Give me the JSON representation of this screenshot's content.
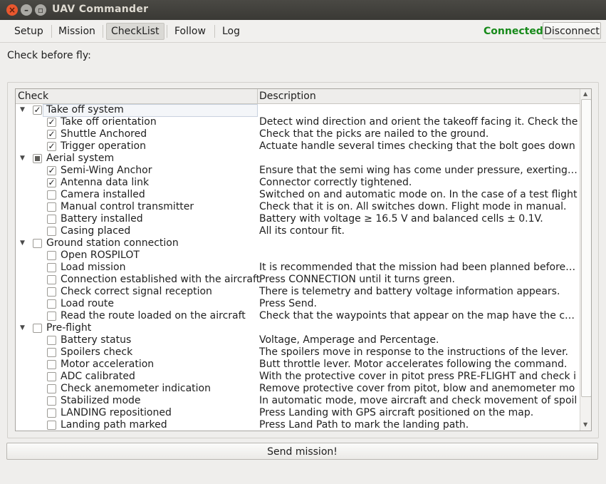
{
  "window": {
    "title": "UAV Commander"
  },
  "menu": {
    "tabs": [
      "Setup",
      "Mission",
      "CheckList",
      "Follow",
      "Log"
    ],
    "active": "CheckList"
  },
  "connection": {
    "status": "Connected",
    "button": "Disconnect",
    "status_color": "#178a1a"
  },
  "section_label": "Check before fly:",
  "tree": {
    "columns": [
      "Check",
      "Description"
    ],
    "groups": [
      {
        "label": "Take off system",
        "state": "checked",
        "items": [
          {
            "label": "Take off orientation",
            "checked": true,
            "desc": "Detect wind direction and orient the takeoff facing it. Check the"
          },
          {
            "label": "Shuttle Anchored",
            "checked": true,
            "desc": "Check that the picks are nailed to the ground."
          },
          {
            "label": "Trigger operation",
            "checked": true,
            "desc": "Actuate handle several times checking that the bolt goes down"
          }
        ]
      },
      {
        "label": "Aerial system",
        "state": "partial",
        "items": [
          {
            "label": "Semi-Wing Anchor",
            "checked": true,
            "desc": "Ensure that the semi wing has come under pressure, exerting fo"
          },
          {
            "label": "Antenna data link",
            "checked": true,
            "desc": "Connector correctly tightened."
          },
          {
            "label": "Camera installed",
            "checked": false,
            "desc": "Switched on and automatic mode on. In the case of a test flight"
          },
          {
            "label": "Manual control transmitter",
            "checked": false,
            "desc": "Check that it is on. All switches down. Flight mode in manual."
          },
          {
            "label": "Battery installed",
            "checked": false,
            "desc": "Battery with voltage ≥ 16.5 V and balanced cells ± 0.1V."
          },
          {
            "label": "Casing placed",
            "checked": false,
            "desc": "All its contour fit."
          }
        ]
      },
      {
        "label": "Ground station connection",
        "state": "unchecked",
        "items": [
          {
            "label": "Open ROSPILOT",
            "checked": false,
            "desc": ""
          },
          {
            "label": "Load mission",
            "checked": false,
            "desc": "It is recommended that the mission had been planned before th"
          },
          {
            "label": "Connection established with the aircraft",
            "checked": false,
            "desc": "Press CONNECTION until it turns green."
          },
          {
            "label": "Check correct signal reception",
            "checked": false,
            "desc": "There is telemetry and battery voltage information appears."
          },
          {
            "label": "Load route",
            "checked": false,
            "desc": "Press Send."
          },
          {
            "label": "Read the route loaded on the aircraft",
            "checked": false,
            "desc": "Check that the waypoints that appear on the map have the corr"
          }
        ]
      },
      {
        "label": "Pre-flight",
        "state": "unchecked",
        "items": [
          {
            "label": "Battery status",
            "checked": false,
            "desc": "Voltage, Amperage and Percentage."
          },
          {
            "label": "Spoilers check",
            "checked": false,
            "desc": "The spoilers move in response to the instructions of the lever."
          },
          {
            "label": "Motor acceleration",
            "checked": false,
            "desc": "Butt throttle lever. Motor accelerates following the command."
          },
          {
            "label": "ADC calibrated",
            "checked": false,
            "desc": "With the protective cover in pitot press PRE-FLIGHT and check i"
          },
          {
            "label": "Check anemometer indication",
            "checked": false,
            "desc": "Remove protective cover from pitot, blow and anemometer mo"
          },
          {
            "label": "Stabilized mode",
            "checked": false,
            "desc": "In automatic mode, move aircraft and check movement of spoil"
          },
          {
            "label": "LANDING repositioned",
            "checked": false,
            "desc": "Press Landing with GPS aircraft positioned on the map."
          },
          {
            "label": "Landing path marked",
            "checked": false,
            "desc": "Press Land Path to mark the landing path."
          }
        ]
      }
    ]
  },
  "footer": {
    "send_button": "Send mission!"
  }
}
